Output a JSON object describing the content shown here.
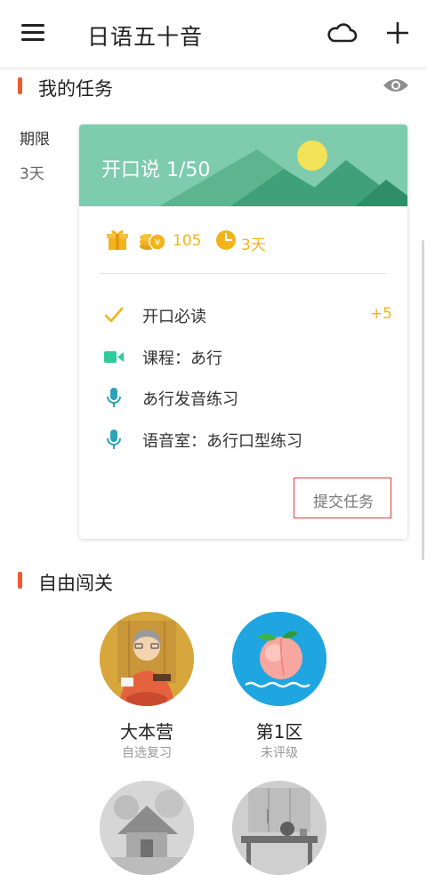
{
  "header": {
    "title": "日语五十音",
    "menu_icon": "hamburger-menu-icon",
    "cloud_icon": "cloud-icon",
    "add_icon": "plus-icon"
  },
  "my_tasks": {
    "title": "我的任务",
    "visibility_icon": "eye-icon",
    "deadline_label": "期限",
    "deadline_value": "3天",
    "card": {
      "title": "开口说 1/50",
      "coins": "105",
      "days": "3天",
      "items": [
        {
          "label": "开口必读",
          "bonus": "+5",
          "icon": "check-icon"
        },
        {
          "label": "课程：あ行",
          "icon": "video-icon"
        },
        {
          "label": "あ行发音练习",
          "icon": "microphone-icon"
        },
        {
          "label": "语音室：あ行口型练习",
          "icon": "microphone-icon"
        }
      ],
      "submit_label": "提交任务"
    }
  },
  "free_levels": {
    "title": "自由闯关",
    "levels": [
      {
        "name": "大本营",
        "status": "自选复习"
      },
      {
        "name": "第1区",
        "status": "未评级"
      }
    ]
  },
  "colors": {
    "accent": "#ef5a30",
    "gold": "#f3b31b",
    "banner_green": "#7ecbae",
    "video_green": "#2ecc9a",
    "mic_teal": "#2aa3b8",
    "submit_border": "#e23b3b"
  }
}
